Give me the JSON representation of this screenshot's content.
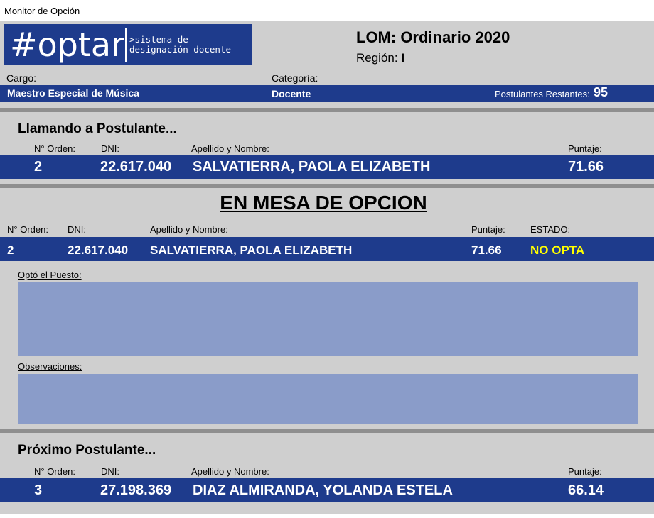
{
  "window": {
    "title": "Monitor de Opción"
  },
  "logo": {
    "brand": "#optar",
    "tagline_line1": ">sistema de",
    "tagline_line2": "designación docente"
  },
  "header": {
    "title": "LOM: Ordinario 2020",
    "region_label": "Región:",
    "region_value": "I",
    "cargo_label": "Cargo:",
    "cargo_value": "Maestro Especial de Música",
    "categoria_label": "Categoría:",
    "categoria_value": "Docente",
    "restantes_label": "Postulantes Restantes:",
    "restantes_value": "95"
  },
  "llamando": {
    "title": "Llamando a Postulante...",
    "col_orden": "N° Orden:",
    "col_dni": "DNI:",
    "col_nombre": "Apellido y Nombre:",
    "col_puntaje": "Puntaje:",
    "orden": "2",
    "dni": "22.617.040",
    "nombre": "SALVATIERRA, PAOLA  ELIZABETH",
    "puntaje": "71.66"
  },
  "mesa": {
    "title": "EN MESA DE OPCION",
    "col_orden": "N° Orden:",
    "col_dni": "DNI:",
    "col_nombre": "Apellido y Nombre:",
    "col_puntaje": "Puntaje:",
    "col_estado": "ESTADO:",
    "orden": "2",
    "dni": "22.617.040",
    "nombre": "SALVATIERRA, PAOLA  ELIZABETH",
    "puntaje": "71.66",
    "estado": "NO OPTA",
    "estado_color": "#ffff00",
    "opto_label": "Optó el Puesto:",
    "opto_value": "",
    "obs_label": "Observaciones:",
    "obs_value": ""
  },
  "proximo": {
    "title": "Próximo Postulante...",
    "col_orden": "N° Orden:",
    "col_dni": "DNI:",
    "col_nombre": "Apellido y Nombre:",
    "col_puntaje": "Puntaje:",
    "orden": "3",
    "dni": "27.198.369",
    "nombre": "DIAZ ALMIRANDA, YOLANDA ESTELA",
    "puntaje": "66.14"
  },
  "colors": {
    "navy": "#1e3b8c",
    "panel": "#cfcfcf",
    "box": "#8a9cc9",
    "separator": "#8f8f8f"
  }
}
